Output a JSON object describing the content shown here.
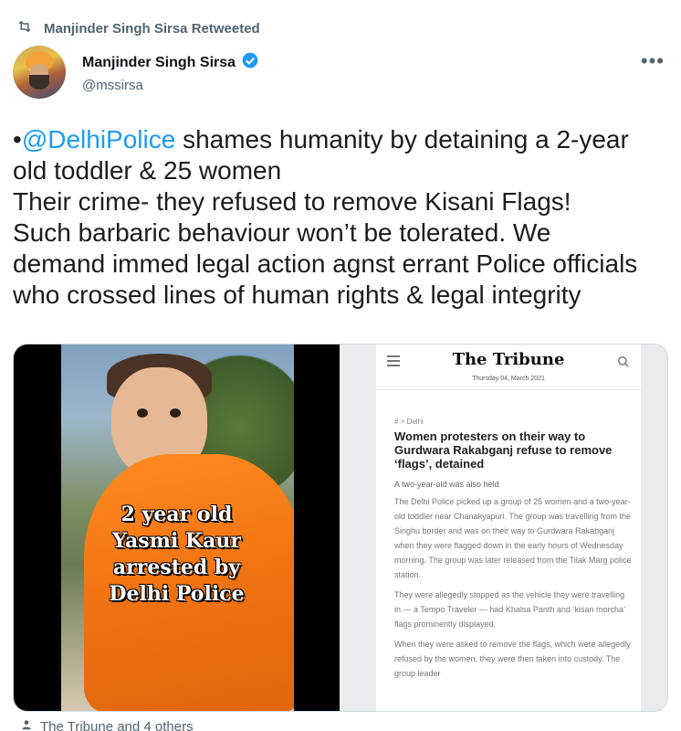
{
  "retweet": {
    "label": "Manjinder Singh Sirsa Retweeted",
    "icon": "retweet-icon"
  },
  "author": {
    "name": "Manjinder Singh Sirsa",
    "handle": "@mssirsa",
    "verified": true,
    "verified_color": "#1d9bf0"
  },
  "menu": {
    "icon": "more-icon",
    "label": "•••"
  },
  "tweet": {
    "bullet": "•",
    "mention": "@DelhiPolice",
    "line1_rest": " shames humanity by detaining a 2-year",
    "line2": "old toddler & 25 women",
    "line3": "Their crime- they refused to remove Kisani Flags!",
    "line4": "Such barbaric behaviour won’t be tolerated. We",
    "line5": "demand immed legal action agnst errant Police officials",
    "line6": "who crossed lines of human rights & legal integrity",
    "mention_color": "#1d9bf0"
  },
  "media": {
    "left": {
      "overlay_lines": [
        "2 year old",
        "Yasmi Kaur",
        "arrested by",
        "Delhi Police"
      ]
    },
    "right": {
      "masthead": "The Tribune",
      "date": "Thursday 04, March 2021",
      "breadcrumb": "# > Delhi",
      "headline": "Women protesters on their way to Gurdwara Rakabganj refuse to remove ‘flags’, detained",
      "standfirst": "A two-year-old was also held",
      "paragraphs": [
        "The Delhi Police picked up a group of 25 women and a two-year-old toddler near Chanakyapuri. The group was travelling from the Singhu border and was on their way to Gurdwara Rakabganj when they were flagged down in the early hours of Wednesday morning. The group was later released from the Tilak Marg police station.",
        "They were allegedly stopped as the vehicle they were travelling in — a Tempo Traveler — had Khalsa Panth and ‘kisan morcha’ flags prominently displayed.",
        "When they were asked to remove the flags, which were allegedly refused by the women, they were then taken into custody. The group leader"
      ]
    }
  },
  "footer": {
    "text": "The Tribune and 4 others",
    "icon": "person-icon"
  }
}
